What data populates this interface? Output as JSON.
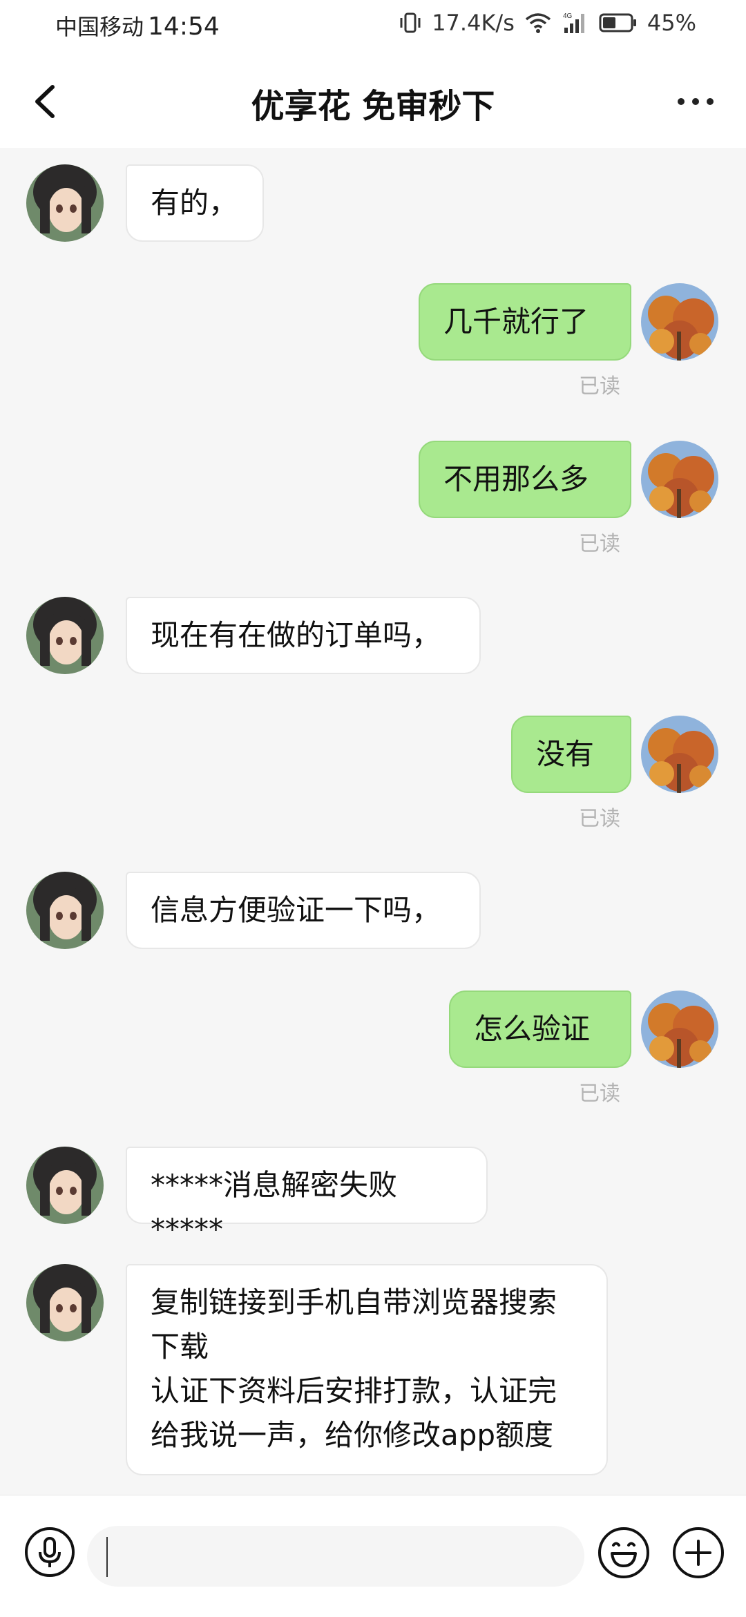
{
  "status_bar": {
    "carrier": "中国移动",
    "time": "14:54",
    "speed": "17.4K/s",
    "battery": "45%",
    "icons": [
      "vibrate-icon",
      "wifi-icon",
      "signal-4g-icon",
      "battery-icon"
    ]
  },
  "header": {
    "title": "优享花 免审秒下",
    "icons": [
      "back-arrow-icon",
      "more-icon"
    ]
  },
  "messages": [
    {
      "side": "in",
      "text": "有的，"
    },
    {
      "side": "out",
      "text": "几千就行了",
      "status": "已读"
    },
    {
      "side": "out",
      "text": "不用那么多",
      "status": "已读"
    },
    {
      "side": "in",
      "text": "现在有在做的订单吗，"
    },
    {
      "side": "out",
      "text": "没有",
      "status": "已读"
    },
    {
      "side": "in",
      "text": "信息方便验证一下吗，"
    },
    {
      "side": "out",
      "text": "怎么验证",
      "status": "已读"
    },
    {
      "side": "in",
      "text": "*****消息解密失败*****"
    },
    {
      "side": "in",
      "text": "复制链接到手机自带浏览器搜索\n下载\n认证下资料后安排打款，认证完\n给我说一声，给你修改app额度"
    }
  ],
  "input_bar": {
    "text": "",
    "icons": [
      "microphone-icon",
      "emoji-icon",
      "plus-icon"
    ]
  },
  "colors": {
    "outgoing_bubble": "#a9e98f",
    "incoming_bubble": "#ffffff",
    "background": "#f6f6f6",
    "read_status": "#b3b3b3"
  }
}
